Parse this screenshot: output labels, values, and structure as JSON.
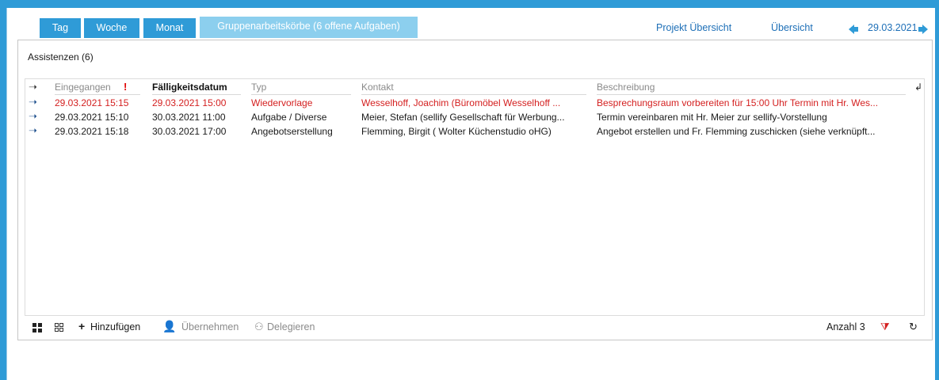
{
  "tabs": [
    {
      "label": "Tag"
    },
    {
      "label": "Woche"
    },
    {
      "label": "Monat"
    },
    {
      "label": "Gruppenarbeitskörbe (6 offene Aufgaben)",
      "active": true
    }
  ],
  "nav": {
    "projekt_label": "Projekt Übersicht",
    "uebersicht_label": "Übersicht",
    "date": "29.03.2021"
  },
  "panel": {
    "title": "Assistenzen (6)"
  },
  "columns": {
    "eingegangen": "Eingegangen",
    "faelligkeit": "Fälligkeitsdatum",
    "typ": "Typ",
    "kontakt": "Kontakt",
    "beschreibung": "Beschreibung"
  },
  "rows": [
    {
      "eingegangen": "29.03.2021 15:15",
      "faelligkeit": "29.03.2021 15:00",
      "typ": "Wiedervorlage",
      "kontakt": "Wesselhoff, Joachim (Büromöbel Wesselhoff ...",
      "beschreibung": "Besprechungsraum vorbereiten für 15:00 Uhr Termin mit Hr. Wes...",
      "overdue": true
    },
    {
      "eingegangen": "29.03.2021 15:10",
      "faelligkeit": "30.03.2021 11:00",
      "typ": "Aufgabe / Diverse",
      "kontakt": "Meier, Stefan (sellify Gesellschaft für Werbung...",
      "beschreibung": "Termin vereinbaren mit Hr. Meier zur sellify-Vorstellung",
      "overdue": false
    },
    {
      "eingegangen": "29.03.2021 15:18",
      "faelligkeit": "30.03.2021 17:00",
      "typ": "Angebotserstellung",
      "kontakt": "Flemming, Birgit ( Wolter Küchenstudio oHG)",
      "beschreibung": "Angebot erstellen und Fr. Flemming zuschicken (siehe verknüpft...",
      "overdue": false
    }
  ],
  "toolbar": {
    "add_label": "Hinzufügen",
    "take_label": "Übernehmen",
    "delegate_label": "Delegieren",
    "count_label": "Anzahl 3"
  },
  "colors": {
    "accent": "#2f9bd7",
    "active_tab": "#8ccfee",
    "overdue": "#d42020",
    "link": "#1d6fb7"
  }
}
